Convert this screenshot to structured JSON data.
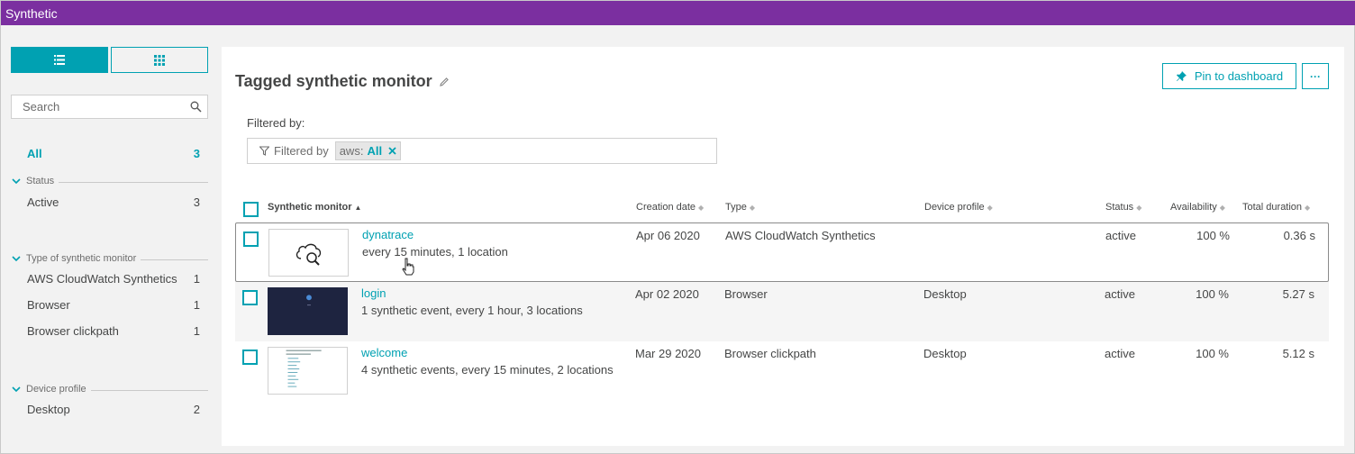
{
  "app": {
    "title": "Synthetic"
  },
  "sidebar": {
    "search_placeholder": "Search",
    "all": {
      "label": "All",
      "count": "3"
    },
    "groups": [
      {
        "title": "Status",
        "items": [
          {
            "label": "Active",
            "count": "3"
          }
        ]
      },
      {
        "title": "Type of synthetic monitor",
        "items": [
          {
            "label": "AWS CloudWatch Synthetics",
            "count": "1"
          },
          {
            "label": "Browser",
            "count": "1"
          },
          {
            "label": "Browser clickpath",
            "count": "1"
          }
        ]
      },
      {
        "title": "Device profile",
        "items": [
          {
            "label": "Desktop",
            "count": "2"
          }
        ]
      }
    ]
  },
  "main": {
    "title": "Tagged synthetic monitor",
    "pin_label": "Pin to dashboard",
    "more_label": "···",
    "filtered_by_label": "Filtered by:",
    "filter": {
      "prefix": "Filtered by",
      "key": "aws:",
      "value": "All"
    },
    "columns": {
      "monitor": "Synthetic monitor",
      "creation_date": "Creation date",
      "type": "Type",
      "device_profile": "Device profile",
      "status": "Status",
      "availability": "Availability",
      "total_duration": "Total duration"
    },
    "rows": [
      {
        "name": "dynatrace",
        "desc": "every 15 minutes, 1 location",
        "date": "Apr 06 2020",
        "type": "AWS CloudWatch Synthetics",
        "device": "",
        "status": "active",
        "availability": "100 %",
        "duration": "0.36 s"
      },
      {
        "name": "login",
        "desc": "1 synthetic event, every 1 hour, 3 locations",
        "date": "Apr 02 2020",
        "type": "Browser",
        "device": "Desktop",
        "status": "active",
        "availability": "100 %",
        "duration": "5.27 s"
      },
      {
        "name": "welcome",
        "desc": "4 synthetic events, every 15 minutes, 2 locations",
        "date": "Mar 29 2020",
        "type": "Browser clickpath",
        "device": "Desktop",
        "status": "active",
        "availability": "100 %",
        "duration": "5.12 s"
      }
    ]
  },
  "colors": {
    "accent": "#00a1b2",
    "topbar": "#7b2fa0"
  }
}
